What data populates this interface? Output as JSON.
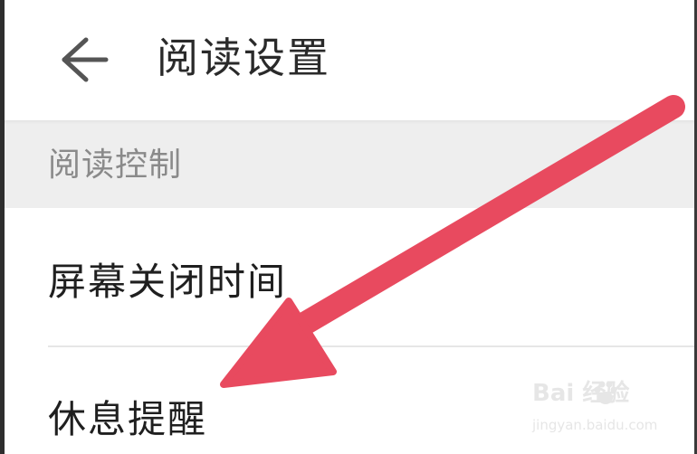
{
  "header": {
    "back_icon": "arrow-left-icon",
    "title": "阅读设置"
  },
  "section": {
    "label": "阅读控制"
  },
  "items": [
    {
      "label": "屏幕关闭时间"
    },
    {
      "label": "休息提醒"
    }
  ],
  "annotation": {
    "arrow_color": "#e84a5f",
    "arrow_icon": "annotation-arrow-icon"
  },
  "watermark": {
    "logo_text": "Bai  经验",
    "url_text": "jingyan.baidu.com",
    "icon": "baidu-paw-icon"
  },
  "colors": {
    "background": "#ffffff",
    "section_background": "#eeeeee",
    "title_text": "#2a2a2a",
    "section_text": "#8a8a8a",
    "item_text": "#1f1f1f",
    "divider": "#e6e6e6"
  }
}
